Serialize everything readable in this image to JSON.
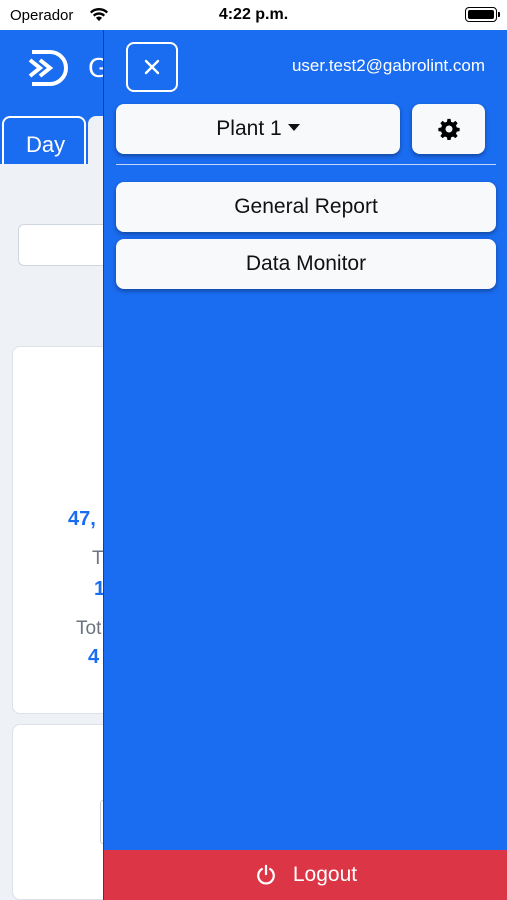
{
  "status_bar": {
    "carrier": "Operador",
    "time": "4:22 p.m."
  },
  "app": {
    "title_partial": "G",
    "tabs": [
      {
        "label": "Day"
      }
    ],
    "background_values": {
      "value1": "47,",
      "label2": "T",
      "value2": "1",
      "label3": "Tot",
      "value3": "4"
    }
  },
  "drawer": {
    "user_email": "user.test2@gabrolint.com",
    "plant_selector": {
      "label": "Plant 1"
    },
    "menu": [
      {
        "label": "General Report"
      },
      {
        "label": "Data Monitor"
      }
    ],
    "logout_label": "Logout"
  },
  "colors": {
    "primary": "#1a6cf0",
    "danger": "#dc3545",
    "button_bg": "#f8f9fa"
  }
}
